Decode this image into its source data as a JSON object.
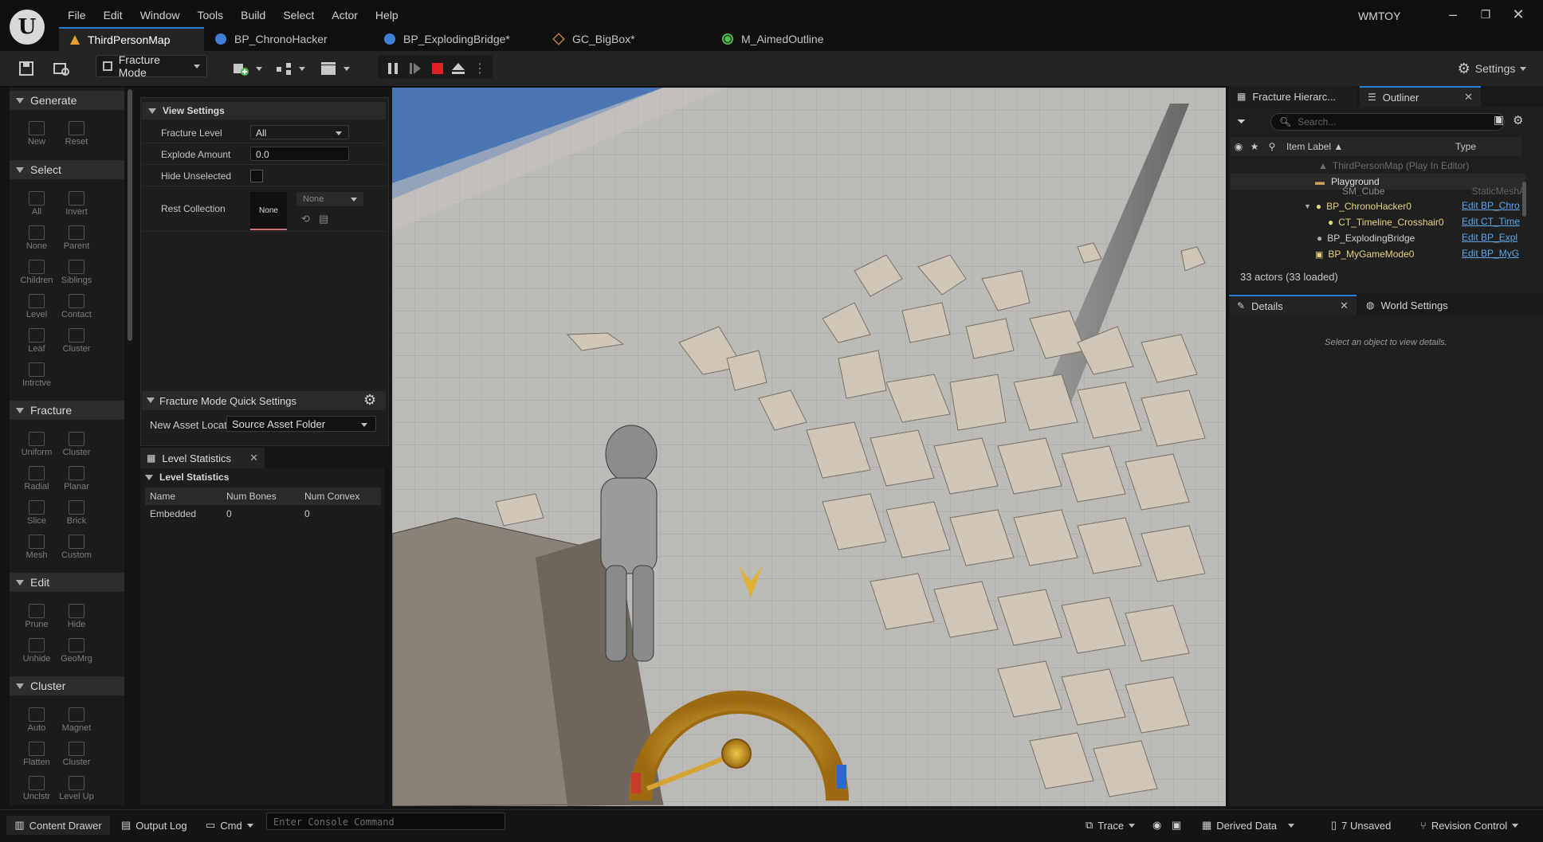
{
  "menu": [
    "File",
    "Edit",
    "Window",
    "Tools",
    "Build",
    "Select",
    "Actor",
    "Help"
  ],
  "tabs": [
    {
      "label": "ThirdPersonMap",
      "active": true
    },
    {
      "label": "BP_ChronoHacker"
    },
    {
      "label": "BP_ExplodingBridge*"
    },
    {
      "label": "GC_BigBox*"
    },
    {
      "label": "M_AimedOutline"
    }
  ],
  "window_title": "WMTOY",
  "toolbar": {
    "mode_label": "Fracture Mode",
    "settings_label": "Settings"
  },
  "palette": {
    "sections": [
      {
        "title": "Generate",
        "buttons": [
          "New",
          "Reset"
        ]
      },
      {
        "title": "Select",
        "buttons": [
          "All",
          "Invert",
          "None",
          "Parent",
          "Children",
          "Siblings",
          "Level",
          "Contact",
          "Leaf",
          "Cluster",
          "Intrctve"
        ]
      },
      {
        "title": "Fracture",
        "buttons": [
          "Uniform",
          "Cluster",
          "Radial",
          "Planar",
          "Slice",
          "Brick",
          "Mesh",
          "Custom"
        ]
      },
      {
        "title": "Edit",
        "buttons": [
          "Prune",
          "Hide",
          "Unhide",
          "GeoMrg"
        ]
      },
      {
        "title": "Cluster",
        "buttons": [
          "Auto",
          "Magnet",
          "Flatten",
          "Cluster",
          "Unclstr",
          "Level Up"
        ]
      }
    ]
  },
  "view_settings": {
    "title": "View Settings",
    "fracture_level_label": "Fracture Level",
    "fracture_level_value": "All",
    "explode_amount_label": "Explode Amount",
    "explode_amount_value": "0.0",
    "hide_unselected_label": "Hide Unselected",
    "rest_collection_label": "Rest Collection",
    "rest_collection_thumb": "None",
    "rest_collection_value": "None"
  },
  "quick_settings": {
    "title": "Fracture Mode Quick Settings",
    "asset_label": "New Asset Locat",
    "asset_value": "Source Asset Folder"
  },
  "level_stats": {
    "tab_label": "Level Statistics",
    "section": "Level Statistics",
    "columns": [
      "Name",
      "Num Bones",
      "Num Convex"
    ],
    "rows": [
      [
        "Embedded",
        "0",
        "0"
      ]
    ]
  },
  "outliner": {
    "tab_fracture": "Fracture Hierarc...",
    "tab_outliner": "Outliner",
    "search_placeholder": "Search...",
    "col_label": "Item Label",
    "col_type": "Type",
    "items": [
      {
        "label": "ThirdPersonMap (Play In Editor)",
        "type": ""
      },
      {
        "label": "Playground",
        "type": ""
      },
      {
        "label": "SM_Cube",
        "type": "StaticMeshA"
      },
      {
        "label": "BP_ChronoHacker0",
        "type": "Edit BP_Chro"
      },
      {
        "label": "CT_Timeline_Crosshair0",
        "type": "Edit CT_Time"
      },
      {
        "label": "BP_ExplodingBridge",
        "type": "Edit BP_Expl"
      },
      {
        "label": "BP_MyGameMode0",
        "type": "Edit BP_MyG"
      }
    ],
    "count": "33 actors (33 loaded)"
  },
  "details": {
    "tab_details": "Details",
    "tab_world": "World Settings",
    "empty": "Select an object to view details."
  },
  "status": {
    "content_drawer": "Content Drawer",
    "output_log": "Output Log",
    "cmd": "Cmd",
    "console_placeholder": "Enter Console Command",
    "trace": "Trace",
    "derived_data": "Derived Data",
    "unsaved": "7 Unsaved",
    "revision": "Revision Control"
  },
  "colors": {
    "accent": "#2a7fd4",
    "link": "#5aa7ea",
    "gauge_gold": "#c8951e",
    "sky": "#4a77b4"
  }
}
